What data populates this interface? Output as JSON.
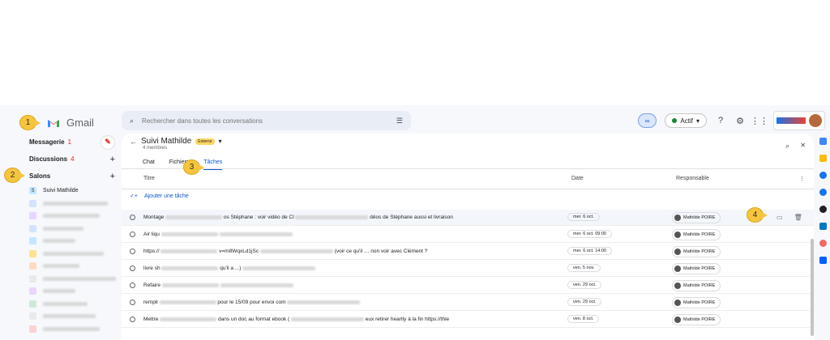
{
  "app_name": "Gmail",
  "search": {
    "placeholder": "Rechercher dans toutes les conversations"
  },
  "status": {
    "label": "Actif"
  },
  "sidebar": {
    "mail": {
      "label": "Messagerie",
      "count": "1"
    },
    "discussions": {
      "label": "Discussions",
      "count": "4"
    },
    "spaces": {
      "label": "Salons"
    },
    "active_space": "Suivi Mathilde"
  },
  "space": {
    "title": "Suivi Mathilde",
    "external_badge": "Externe",
    "members": "4 membres",
    "tabs": [
      "Chat",
      "Fichiers",
      "Tâches"
    ]
  },
  "tasks": {
    "columns": {
      "title": "Titre",
      "date": "Date",
      "owner": "Responsable"
    },
    "add_label": "Ajouter une tâche",
    "rows": [
      {
        "text_a": "Montage",
        "text_b": "os Stéphane : voir vidéo de Cl",
        "text_c": "déos de Stéphane aussi et livraison",
        "date": "mer. 6 oct.",
        "owner": "Mathilde POIRE"
      },
      {
        "text_a": "Air liqu",
        "text_b": "",
        "text_c": "",
        "date": "mer. 6 oct. 09:00",
        "owner": "Mathilde POIRE"
      },
      {
        "text_a": "https://",
        "text_b": "v=m8WqxLd1jSc",
        "text_c": "(voir ce qu'il … non voir avec Clément ?",
        "date": "mer. 6 oct. 14:00",
        "owner": "Mathilde POIRE"
      },
      {
        "text_a": "livre sh",
        "text_b": "qu'il a ...)",
        "text_c": "",
        "date": "ven. 5 nov.",
        "owner": "Mathilde POIRE"
      },
      {
        "text_a": "Refaire",
        "text_b": "",
        "text_c": "",
        "date": "ven. 29 oct.",
        "owner": "Mathilde POIRE"
      },
      {
        "text_a": "rempli",
        "text_b": "pour le 15/09 pour envoi com",
        "text_c": "",
        "date": "ven. 29 oct.",
        "owner": "Mathilde POIRE"
      },
      {
        "text_a": "Mettre",
        "text_b": "dans un doc au format ebook (",
        "text_c": "eux retirer heartly à la fin https://thie",
        "date": "ven. 8 oct.",
        "owner": "Mathilde POIRE"
      }
    ]
  },
  "callouts": [
    "1",
    "2",
    "3",
    "4"
  ],
  "colors": {
    "accent": "#0b57d0",
    "callout": "#f5c542",
    "external": "#fdd663"
  }
}
